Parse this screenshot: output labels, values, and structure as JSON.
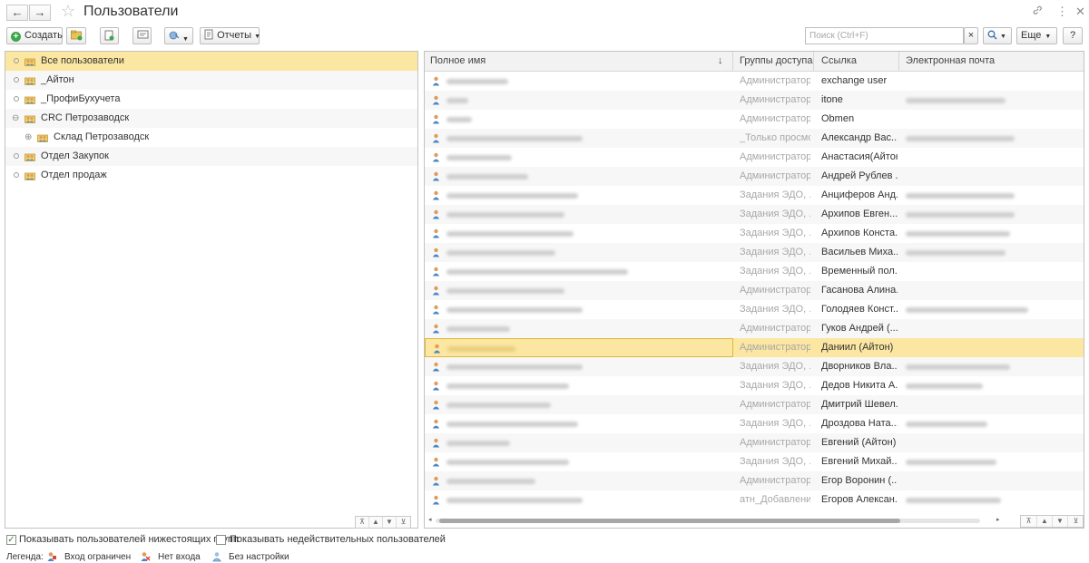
{
  "window": {
    "title": "Пользователи",
    "back_icon": "←",
    "forward_icon": "→",
    "star_icon": "☆",
    "link_icon": "🔗",
    "more_icon": "⋮",
    "close_icon": "✕"
  },
  "toolbar": {
    "create_label": "Создать",
    "reports_label": "Отчеты",
    "search_placeholder": "Поиск (Ctrl+F)",
    "clear_icon": "×",
    "more_label": "Еще",
    "help_label": "?"
  },
  "tree": {
    "items": [
      {
        "label": "Все пользователи",
        "selected": true
      },
      {
        "label": "_Айтон"
      },
      {
        "label": "_ПрофиБухучета"
      },
      {
        "label": "CRC Петрозаводск",
        "expanded": true
      },
      {
        "label": "Склад Петрозаводск",
        "child": true
      },
      {
        "label": "Отдел Закупок"
      },
      {
        "label": "Отдел продаж"
      }
    ]
  },
  "table": {
    "columns": [
      "Полное имя",
      "Группы доступа",
      "Ссылка",
      "Электронная почта"
    ],
    "sort_icon": "↓",
    "rows": [
      {
        "group": "Администратор...",
        "link": "exchange user"
      },
      {
        "group": "Администратор...",
        "link": "itone"
      },
      {
        "group": "Администратор...",
        "link": "Obmen"
      },
      {
        "group": "_Только просмо...",
        "link": "Александр Вас..."
      },
      {
        "group": "Администратор...",
        "link": "Анастасия(Айтон)"
      },
      {
        "group": "Администратор...",
        "link": "Андрей Рублев ..."
      },
      {
        "group": "Задания ЭДО, ...",
        "link": "Анциферов Анд..."
      },
      {
        "group": "Задания ЭДО, ...",
        "link": "Архипов Евген..."
      },
      {
        "group": "Задания ЭДО, ...",
        "link": "Архипов Конста..."
      },
      {
        "group": "Задания ЭДО, ...",
        "link": "Васильев Миха..."
      },
      {
        "group": "Задания ЭДО, ...",
        "link": "Временный пол..."
      },
      {
        "group": "Администратор...",
        "link": "Гасанова Алина..."
      },
      {
        "group": "Задания ЭДО, ...",
        "link": "Голодяев Конст..."
      },
      {
        "group": "Администратор...",
        "link": "Гуков Андрей (..."
      },
      {
        "group": "Администратор...",
        "link": "Даниил (Айтон)",
        "selected": true
      },
      {
        "group": "Задания ЭДО, ...",
        "link": "Дворников Вла..."
      },
      {
        "group": "Задания ЭДО, ...",
        "link": "Дедов Никита А..."
      },
      {
        "group": "Администратор...",
        "link": "Дмитрий Шевел..."
      },
      {
        "group": "Задания ЭДО, ...",
        "link": "Дроздова Ната..."
      },
      {
        "group": "Администратор...",
        "link": "Евгений (Айтон)"
      },
      {
        "group": "Задания ЭДО, ...",
        "link": "Евгений Михай..."
      },
      {
        "group": "Администратор...",
        "link": "Егор Воронин (..."
      },
      {
        "group": "атн_Добавлени...",
        "link": "Егоров Алексан..."
      }
    ]
  },
  "footer": {
    "show_subordinate_label": "Показывать пользователей нижестоящих групп",
    "show_subordinate_checked": true,
    "show_invalid_label": "Показывать недействительных пользователей",
    "show_invalid_checked": false,
    "legend_label": "Легенда:",
    "legend_items": [
      "Вход ограничен",
      "Нет входа",
      "Без настройки"
    ]
  }
}
